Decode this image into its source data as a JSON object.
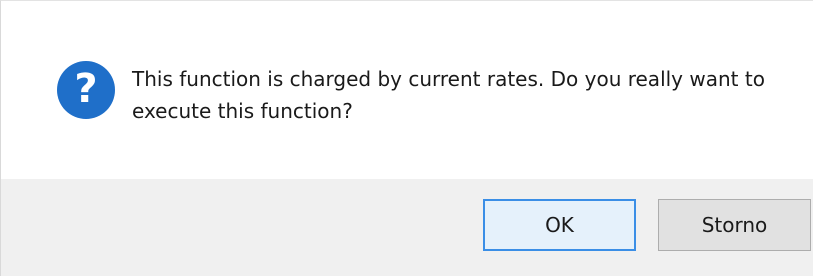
{
  "dialog": {
    "message": "This function is charged by current rates. Do you really want to execute this function?",
    "icon": "question-icon",
    "icon_glyph": "?",
    "accent_color": "#1f6fc9"
  },
  "buttons": {
    "ok_label": "OK",
    "storno_label": "Storno"
  }
}
